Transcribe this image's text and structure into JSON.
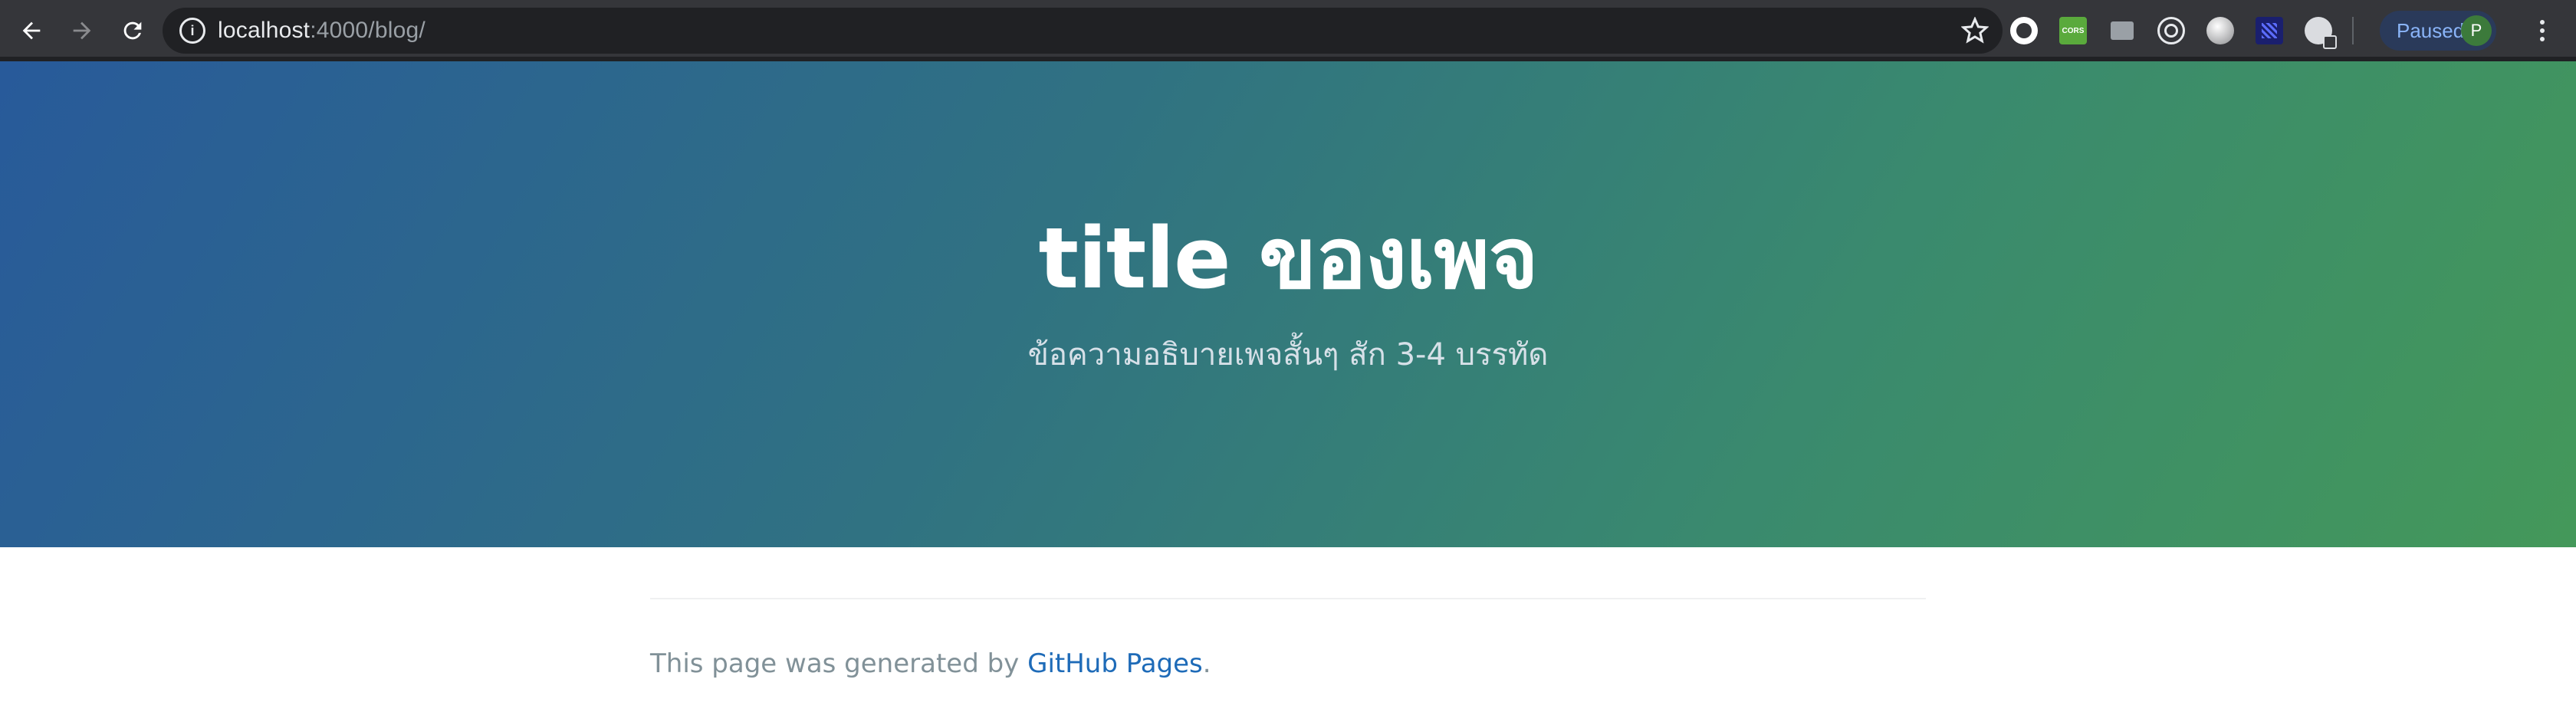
{
  "browser": {
    "url_host": "localhost",
    "url_path": ":4000/blog/",
    "profile_label": "Paused",
    "profile_initial": "P",
    "icons": [
      "back-arrow-icon",
      "forward-arrow-icon",
      "reload-icon",
      "info-icon",
      "star-icon",
      "menu-dots-icon"
    ],
    "extensions": [
      {
        "name": "ext-dark-circle-icon",
        "label": ""
      },
      {
        "name": "ext-cors-icon",
        "label": "CORS",
        "color": "#5aaa3c"
      },
      {
        "name": "ext-comment-icon",
        "label": ""
      },
      {
        "name": "ext-target-icon",
        "label": ""
      },
      {
        "name": "ext-grey-ball-icon",
        "label": ""
      },
      {
        "name": "ext-pixel-icon",
        "label": ""
      },
      {
        "name": "ext-globe-icon",
        "label": ""
      }
    ]
  },
  "hero": {
    "title": "title ของเพจ",
    "tagline": "ข้อความอธิบายเพจสั้นๆ สัก 3-4 บรรทัด",
    "gradient_start": "#285a9a",
    "gradient_end": "#44985a"
  },
  "footer": {
    "text_before": "This page was generated by ",
    "link_text": "GitHub Pages",
    "text_after": "."
  },
  "colors": {
    "link": "#1e6bb8",
    "footer_text": "#819198",
    "chrome_bg": "#35363a"
  }
}
